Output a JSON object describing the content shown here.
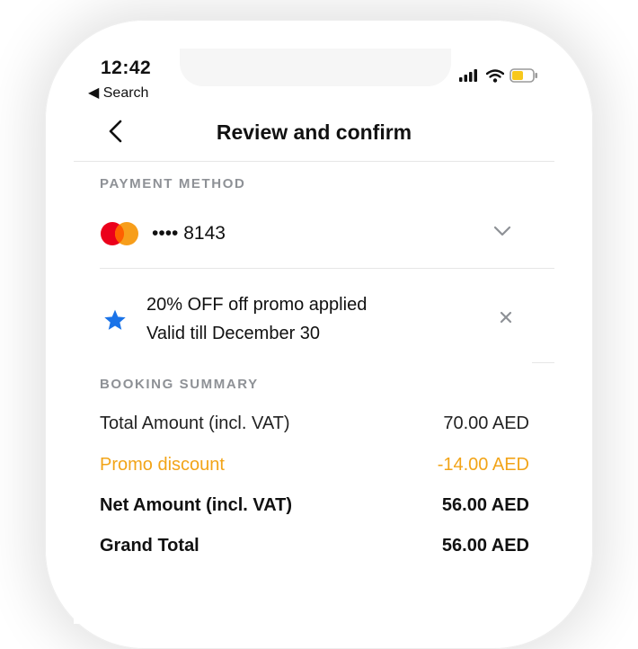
{
  "status_bar": {
    "time": "12:42",
    "back_label": "◀ Search"
  },
  "header": {
    "title": "Review and confirm"
  },
  "payment": {
    "section_label": "PAYMENT METHOD",
    "card_number": "•••• 8143",
    "brand_colors": [
      "#eb001b",
      "#f79e1b"
    ]
  },
  "promo": {
    "line1": "20% OFF off promo applied",
    "line2": "Valid till December 30",
    "star_color": "#1a73e8"
  },
  "summary": {
    "section_label": "BOOKING SUMMARY",
    "rows": [
      {
        "label": "Total Amount (incl. VAT)",
        "value": "70.00 AED"
      },
      {
        "label": "Promo discount",
        "value": "-14.00 AED"
      },
      {
        "label": "Net Amount (incl. VAT)",
        "value": "56.00 AED"
      },
      {
        "label": "Grand Total",
        "value": "56.00 AED"
      }
    ],
    "promo_color": "#f2a418"
  }
}
